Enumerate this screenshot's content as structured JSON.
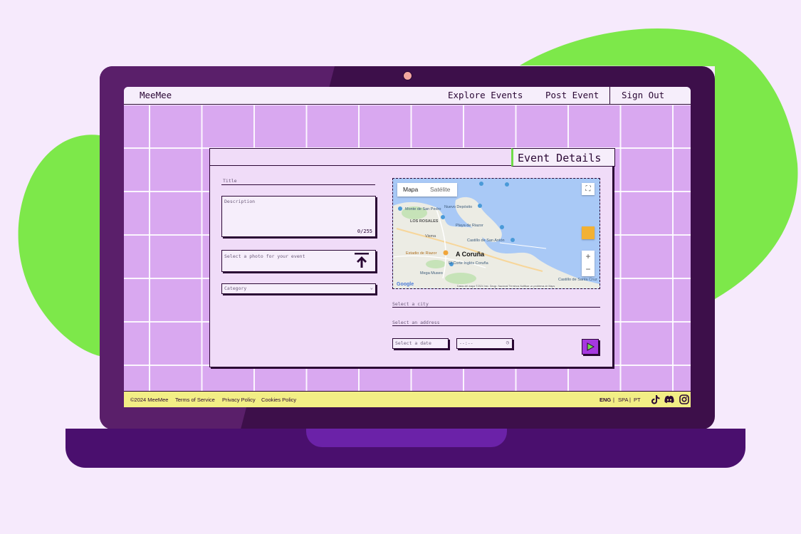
{
  "nav": {
    "brand": "MeeMee",
    "explore": "Explore Events",
    "post": "Post Event",
    "signout": "Sign Out"
  },
  "card": {
    "title": "Event Details",
    "title_label": "Title",
    "description_placeholder": "Description",
    "description_counter": "0/255",
    "photo_placeholder": "Select a photo for your event",
    "category_placeholder": "Category",
    "city_placeholder": "Select a city",
    "address_placeholder": "Select an address",
    "date_placeholder": "Select a date",
    "time_placeholder": "--:--"
  },
  "map": {
    "tab_map": "Mapa",
    "tab_satellite": "Satélite",
    "city": "A Coruña",
    "places": [
      "Monte de San Pedro",
      "LOS ROSALES",
      "Visma",
      "Nuevo Depósito",
      "Playa de Riazor",
      "Castillo de San Antón",
      "Estadio de Riazor",
      "El Corte Inglés Coruña",
      "Mega Museo",
      "Castillo de Santa Cruz"
    ],
    "credits": "Datos del mapa ©2024 Inst. Geogr. Nacional   Términos   Notificar un problema de Maps"
  },
  "footer": {
    "copyright": "©2024 MeeMee",
    "terms": "Terms of Service",
    "privacy": "Privacy Policy",
    "cookies": "Cookies Policy",
    "lang_en": "ENG",
    "lang_es": "SPA",
    "lang_pt": "PT"
  },
  "colors": {
    "background": "#f6eafc",
    "blob": "#7de84a",
    "laptop": "#3d0f4a",
    "screen": "#d9a8f0",
    "footer": "#f2ee85",
    "accent": "#a638e0"
  },
  "icons": [
    "upload-icon",
    "chevron-down-icon",
    "clock-icon",
    "play-icon",
    "tiktok-icon",
    "discord-icon",
    "instagram-icon",
    "fullscreen-icon",
    "pegman-icon",
    "zoom-in-icon",
    "zoom-out-icon",
    "map-pin-icon"
  ]
}
